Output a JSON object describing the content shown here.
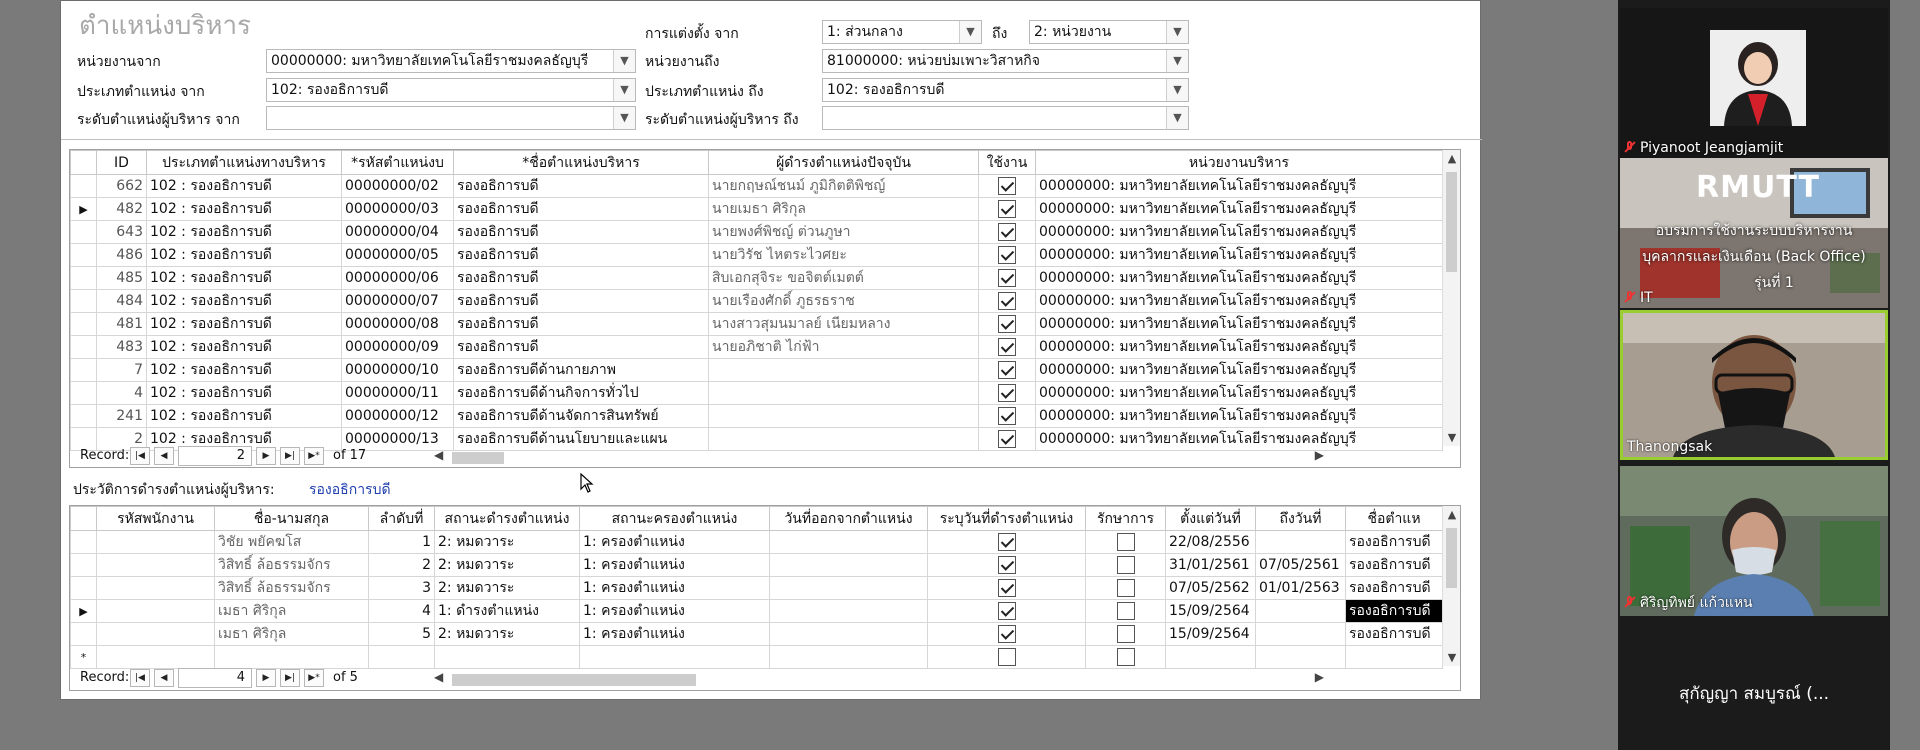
{
  "form": {
    "title": "ตำแหน่งบริหาร",
    "filters": {
      "org_from_label": "หน่วยงานจาก",
      "org_from_value": "00000000: มหาวิทยาลัยเทคโนโลยีราชมงคลธัญบุรี",
      "org_to_label": "หน่วยงานถึง",
      "org_to_value": "81000000: หน่วยบ่มเพาะวิสาหกิจ",
      "appoint_from_label": "การแต่งตั้ง จาก",
      "appoint_from_value": "1: ส่วนกลาง",
      "appoint_to_label": "ถึง",
      "appoint_to_value": "2: หน่วยงาน",
      "ptype_from_label": "ประเภทตำแหน่ง จาก",
      "ptype_from_value": "102: รองอธิการบดี",
      "ptype_to_label": "ประเภทตำแหน่ง ถึง",
      "ptype_to_value": "102: รองอธิการบดี",
      "level_from_label": "ระดับตำแหน่งผู้บริหาร จาก",
      "level_from_value": "",
      "level_to_label": "ระดับตำแหน่งผู้บริหาร ถึง",
      "level_to_value": ""
    },
    "positions": {
      "columns": [
        "ID",
        "ประเภทตำแหน่งทางบริหาร",
        "*รหัสตำแหน่งบ",
        "*ชื่อตำแหน่งบริหาร",
        "ผู้ดำรงตำแหน่งปัจจุบัน",
        "ใช้งาน",
        "หน่วยงานบริหาร"
      ],
      "current_row_index": 1,
      "rows": [
        {
          "id": "662",
          "type": "102 : รองอธิการบดี",
          "code": "00000000/02",
          "name": "รองอธิการบดี",
          "holder": "นายกฤษณ์ชนม์ ภูมิกิตติพิชญ์",
          "active": true,
          "org": "00000000: มหาวิทยาลัยเทคโนโลยีราชมงคลธัญบุรี"
        },
        {
          "id": "482",
          "type": "102 : รองอธิการบดี",
          "code": "00000000/03",
          "name": "รองอธิการบดี",
          "holder": "นายเมธา ศิริกุล",
          "active": true,
          "org": "00000000: มหาวิทยาลัยเทคโนโลยีราชมงคลธัญบุรี"
        },
        {
          "id": "643",
          "type": "102 : รองอธิการบดี",
          "code": "00000000/04",
          "name": "รองอธิการบดี",
          "holder": "นายพงศ์พิชญ์ ต่วนภูษา",
          "active": true,
          "org": "00000000: มหาวิทยาลัยเทคโนโลยีราชมงคลธัญบุรี"
        },
        {
          "id": "486",
          "type": "102 : รองอธิการบดี",
          "code": "00000000/05",
          "name": "รองอธิการบดี",
          "holder": "นายวิรัช ไหตระไวศยะ",
          "active": true,
          "org": "00000000: มหาวิทยาลัยเทคโนโลยีราชมงคลธัญบุรี"
        },
        {
          "id": "485",
          "type": "102 : รองอธิการบดี",
          "code": "00000000/06",
          "name": "รองอธิการบดี",
          "holder": "สิบเอกสุจิระ ขอจิตต์เมตต์",
          "active": true,
          "org": "00000000: มหาวิทยาลัยเทคโนโลยีราชมงคลธัญบุรี"
        },
        {
          "id": "484",
          "type": "102 : รองอธิการบดี",
          "code": "00000000/07",
          "name": "รองอธิการบดี",
          "holder": "นายเรืองศักดิ์ ภูธรธราช",
          "active": true,
          "org": "00000000: มหาวิทยาลัยเทคโนโลยีราชมงคลธัญบุรี"
        },
        {
          "id": "481",
          "type": "102 : รองอธิการบดี",
          "code": "00000000/08",
          "name": "รองอธิการบดี",
          "holder": "นางสาวสุมนมาลย์ เนียมหลาง",
          "active": true,
          "org": "00000000: มหาวิทยาลัยเทคโนโลยีราชมงคลธัญบุรี"
        },
        {
          "id": "483",
          "type": "102 : รองอธิการบดี",
          "code": "00000000/09",
          "name": "รองอธิการบดี",
          "holder": "นายอภิชาติ ไก่ฟ้า",
          "active": true,
          "org": "00000000: มหาวิทยาลัยเทคโนโลยีราชมงคลธัญบุรี"
        },
        {
          "id": "7",
          "type": "102 : รองอธิการบดี",
          "code": "00000000/10",
          "name": "รองอธิการบดีด้านกายภาพ",
          "holder": "",
          "active": true,
          "org": "00000000: มหาวิทยาลัยเทคโนโลยีราชมงคลธัญบุรี"
        },
        {
          "id": "4",
          "type": "102 : รองอธิการบดี",
          "code": "00000000/11",
          "name": "รองอธิการบดีด้านกิจการทั่วไป",
          "holder": "",
          "active": true,
          "org": "00000000: มหาวิทยาลัยเทคโนโลยีราชมงคลธัญบุรี"
        },
        {
          "id": "241",
          "type": "102 : รองอธิการบดี",
          "code": "00000000/12",
          "name": "รองอธิการบดีด้านจัดการสินทรัพย์",
          "holder": "",
          "active": true,
          "org": "00000000: มหาวิทยาลัยเทคโนโลยีราชมงคลธัญบุรี"
        },
        {
          "id": "2",
          "type": "102 : รองอธิการบดี",
          "code": "00000000/13",
          "name": "รองอธิการบดีด้านนโยบายและแผน",
          "holder": "",
          "active": true,
          "org": "00000000: มหาวิทยาลัยเทคโนโลยีราชมงคลธัญบุรี"
        }
      ],
      "nav": {
        "label": "Record:",
        "current": "2",
        "of_text": "of 17"
      }
    },
    "history": {
      "label": "ประวัติการดำรงตำแหน่งผู้บริหาร:",
      "value": "รองอธิการบดี",
      "columns": [
        "รหัสพนักงาน",
        "ชื่อ-นามสกุล",
        "ลำดับที่",
        "สถานะดำรงตำแหน่ง",
        "สถานะครองตำแหน่ง",
        "วันที่ออกจากตำแหน่ง",
        "ระบุวันที่ดำรงตำแหน่ง",
        "รักษาการ",
        "ตั้งแต่วันที่",
        "ถึงวันที่",
        "ชื่อตำแห"
      ],
      "current_row_index": 3,
      "rows": [
        {
          "emp": "",
          "name": "วิชัย พยัคฆโส",
          "seq": "1",
          "status": "2: หมดวาระ",
          "hold": "1: ครองตำแหน่ง",
          "leave": "",
          "specify": true,
          "acting": false,
          "from": "22/08/2556",
          "to": "",
          "pos": "รองอธิการบดี"
        },
        {
          "emp": "",
          "name": "วิสิทธิ์ ล้อธรรมจักร",
          "seq": "2",
          "status": "2: หมดวาระ",
          "hold": "1: ครองตำแหน่ง",
          "leave": "",
          "specify": true,
          "acting": false,
          "from": "31/01/2561",
          "to": "07/05/2561",
          "pos": "รองอธิการบดี"
        },
        {
          "emp": "",
          "name": "วิสิทธิ์ ล้อธรรมจักร",
          "seq": "3",
          "status": "2: หมดวาระ",
          "hold": "1: ครองตำแหน่ง",
          "leave": "",
          "specify": true,
          "acting": false,
          "from": "07/05/2562",
          "to": "01/01/2563",
          "pos": "รองอธิการบดี"
        },
        {
          "emp": "",
          "name": "เมธา ศิริกุล",
          "seq": "4",
          "status": "1: ดำรงตำแหน่ง",
          "hold": "1: ครองตำแหน่ง",
          "leave": "",
          "specify": true,
          "acting": false,
          "from": "15/09/2564",
          "to": "",
          "pos": "รองอธิการบดี"
        },
        {
          "emp": "",
          "name": "เมธา ศิริกุล",
          "seq": "5",
          "status": "2: หมดวาระ",
          "hold": "1: ครองตำแหน่ง",
          "leave": "",
          "specify": true,
          "acting": false,
          "from": "15/09/2564",
          "to": "",
          "pos": "รองอธิการบดี"
        }
      ],
      "new_row_marker": "*",
      "nav": {
        "label": "Record:",
        "current": "4",
        "of_text": "of 5"
      }
    }
  },
  "participants": [
    {
      "name": "Piyanoot Jeangjamjit",
      "muted": true
    },
    {
      "name": "IT",
      "muted": true,
      "slide_logo": "RMUTT",
      "slide_line1": "อบรมการใช้งานระบบบริหารงาน",
      "slide_line2": "บุคลากรและเงินเดือน (Back Office)",
      "slide_line3": "รุ่นที่ 1"
    },
    {
      "name": "Thanongsak",
      "muted": false
    },
    {
      "name": "ศิริญทิพย์ แก้วแหน",
      "muted": true
    },
    {
      "name": "สุกัญญา สมบูรณ์ (...",
      "muted": false
    }
  ],
  "colors": {
    "active_speaker": "#9acd32",
    "muted_icon": "#e33333",
    "link_text": "#1f3fae"
  }
}
